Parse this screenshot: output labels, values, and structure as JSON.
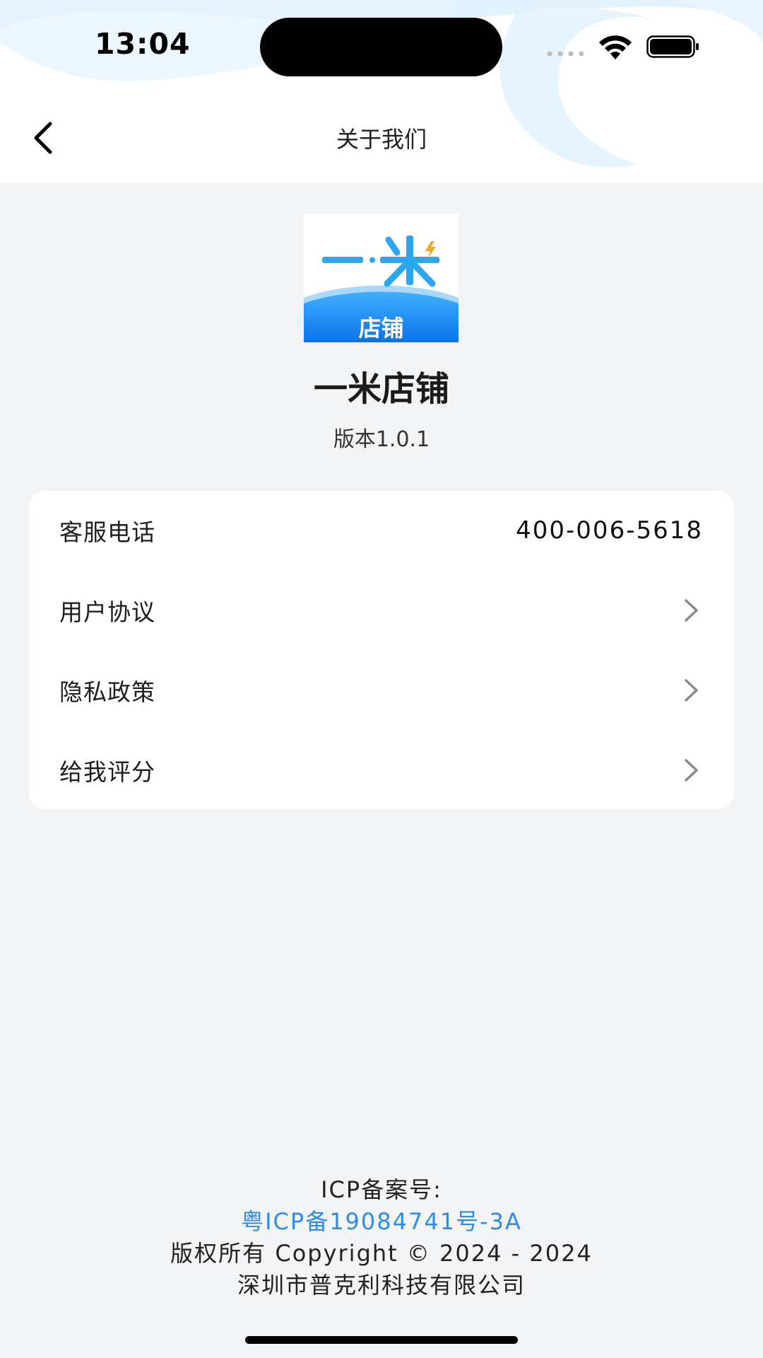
{
  "status_bar": {
    "time": "13:04"
  },
  "nav": {
    "title": "关于我们",
    "back_icon": "chevron-left-icon"
  },
  "app": {
    "logo_text": "一米",
    "logo_subtitle": "店铺",
    "name": "一米店铺",
    "version": "版本1.0.1"
  },
  "menu": {
    "items": [
      {
        "label": "客服电话",
        "value": "400-006-5618"
      },
      {
        "label": "用户协议",
        "icon": "chevron-right-icon"
      },
      {
        "label": "隐私政策",
        "icon": "chevron-right-icon"
      },
      {
        "label": "给我评分",
        "icon": "chevron-right-icon"
      }
    ]
  },
  "footer": {
    "icp_label": "ICP备案号:",
    "icp_number": "粤ICP备19084741号-3A",
    "copyright": "版权所有 Copyright © 2024 - 2024",
    "company": "深圳市普克利科技有限公司"
  },
  "colors": {
    "accent": "#2f8bea",
    "page_background": "#f3f4f6",
    "logo_blue": "#1e88f0",
    "logo_light_blue": "#2ba7f0",
    "logo_bolt": "#f5a623"
  }
}
